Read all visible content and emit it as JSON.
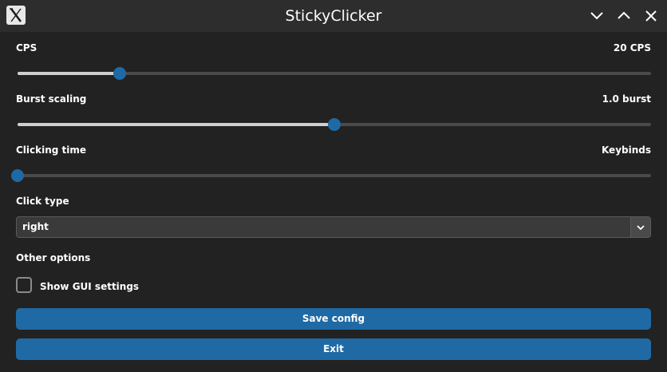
{
  "window": {
    "title": "StickyClicker",
    "icon": "x-logo-icon",
    "controls": [
      "minimize-icon",
      "maximize-icon"
    ]
  },
  "cps": {
    "label": "CPS",
    "value_text": "20 CPS",
    "fraction": 0.161
  },
  "burst": {
    "label": "Burst scaling",
    "value_text": "1.0 burst",
    "fraction": 0.5
  },
  "clicking_time": {
    "label": "Clicking time",
    "value_text": "Keybinds",
    "fraction": 0.0
  },
  "click_type": {
    "label": "Click type",
    "selected": "right",
    "icon": "chevron-down-icon"
  },
  "other_options": {
    "label": "Other options",
    "show_gui_label": "Show GUI settings",
    "show_gui_checked": false
  },
  "buttons": {
    "save": "Save config",
    "exit": "Exit"
  },
  "colors": {
    "accent": "#1f6aa5",
    "background": "#222222",
    "titlebar": "#2d2d2d"
  }
}
